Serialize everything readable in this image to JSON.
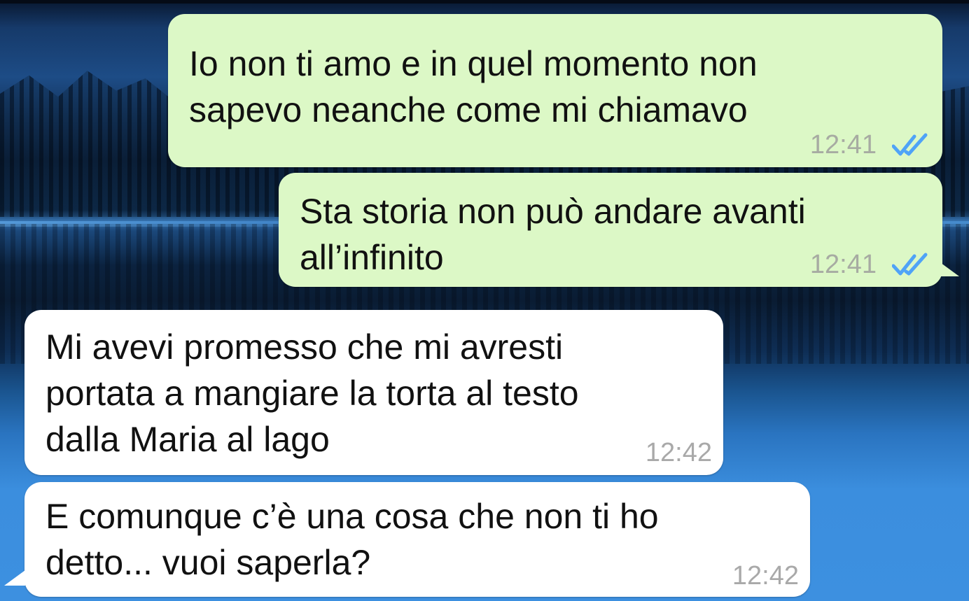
{
  "chat": {
    "messages": [
      {
        "direction": "outgoing",
        "text": "Io non ti amo e in quel momento non\nsapevo neanche come mi chiamavo",
        "time": "12:41",
        "status_icon": "double-check-read-icon"
      },
      {
        "direction": "outgoing",
        "text": "Sta storia non può andare avanti\nall’infinito",
        "time": "12:41",
        "status_icon": "double-check-read-icon"
      },
      {
        "direction": "incoming",
        "text": "Mi avevi promesso che mi avresti\nportata a mangiare la torta al testo\ndalla Maria al lago",
        "time": "12:42"
      },
      {
        "direction": "incoming",
        "text": "E comunque c’è una cosa che non ti ho\ndetto... vuoi saperla?",
        "time": "12:42"
      }
    ]
  },
  "colors": {
    "outgoing_bubble": "#dcf8c6",
    "incoming_bubble": "#ffffff",
    "read_ticks": "#4fa3f7",
    "timestamp": "#a7aba2"
  },
  "wallpaper": "mountain-lake-at-night"
}
